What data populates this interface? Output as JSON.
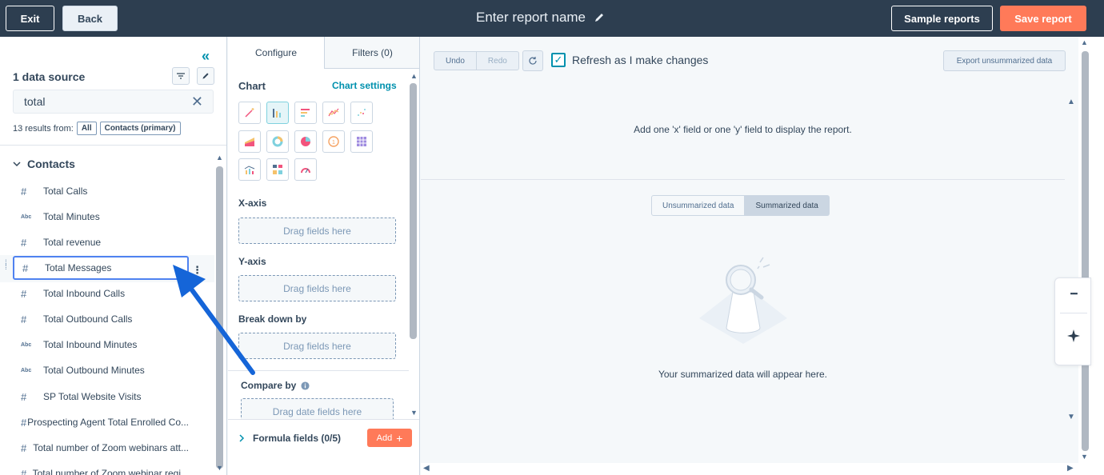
{
  "topbar": {
    "exit_label": "Exit",
    "back_label": "Back",
    "report_name_placeholder": "Enter report name",
    "sample_reports_label": "Sample reports",
    "save_report_label": "Save report"
  },
  "left_panel": {
    "data_source_title": "1 data source",
    "search_value": "total",
    "results_text": "13 results from:",
    "filter_all": "All",
    "filter_contacts": "Contacts (primary)",
    "group_label": "Contacts",
    "fields": [
      {
        "type": "#",
        "label": "Total Calls"
      },
      {
        "type": "Abc",
        "label": "Total Minutes"
      },
      {
        "type": "#",
        "label": "Total revenue"
      },
      {
        "type": "#",
        "label": "Total Messages"
      },
      {
        "type": "#",
        "label": "Total Inbound Calls"
      },
      {
        "type": "#",
        "label": "Total Outbound Calls"
      },
      {
        "type": "Abc",
        "label": "Total Inbound Minutes"
      },
      {
        "type": "Abc",
        "label": "Total Outbound Minutes"
      },
      {
        "type": "#",
        "label": "SP Total Website Visits"
      },
      {
        "type": "#",
        "label": "Prospecting Agent Total Enrolled Co..."
      },
      {
        "type": "#",
        "label": "Total number of Zoom webinars att..."
      },
      {
        "type": "#",
        "label": "Total number of Zoom webinar regi..."
      }
    ],
    "field_menu": "⋮"
  },
  "config_panel": {
    "tab_configure": "Configure",
    "tab_filters": "Filters (0)",
    "chart_title": "Chart",
    "chart_settings_link": "Chart settings",
    "xaxis_title": "X-axis",
    "yaxis_title": "Y-axis",
    "breakdown_title": "Break down by",
    "compare_title": "Compare by",
    "drag_fields": "Drag fields here",
    "drag_date_fields": "Drag date fields here",
    "formula_label": "Formula fields (0/5)",
    "add_label": "Add"
  },
  "main": {
    "undo_label": "Undo",
    "redo_label": "Redo",
    "refresh_label": "Refresh as I make changes",
    "export_label": "Export unsummarized data",
    "empty_top_message": "Add one 'x' field or one 'y' field to display the report.",
    "unsummarized_label": "Unsummarized data",
    "summarized_label": "Summarized data",
    "empty_bottom_message": "Your summarized data will appear here."
  },
  "colors": {
    "topbar_bg": "#2d3e50",
    "accent_orange": "#ff7a59",
    "link_teal": "#0091ae",
    "annotation_blue": "#1565d8"
  }
}
